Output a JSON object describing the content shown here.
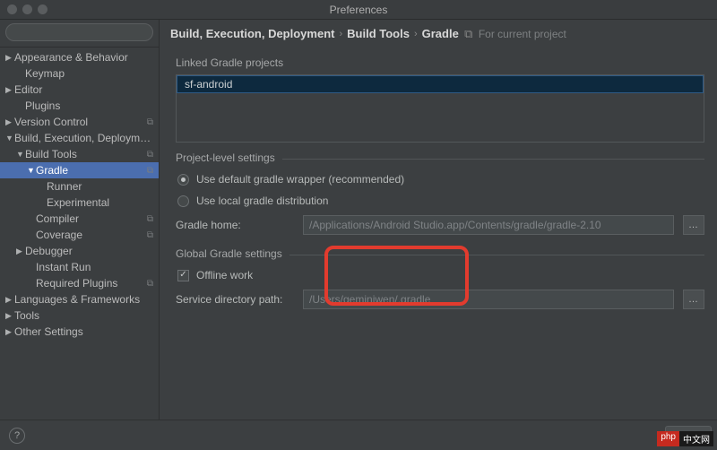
{
  "window": {
    "title": "Preferences"
  },
  "search": {
    "placeholder": ""
  },
  "sidebar": {
    "items": [
      {
        "label": "Appearance & Behavior",
        "indent": 0,
        "arrow": "▶",
        "badge": ""
      },
      {
        "label": "Keymap",
        "indent": 1,
        "arrow": "",
        "badge": ""
      },
      {
        "label": "Editor",
        "indent": 0,
        "arrow": "▶",
        "badge": ""
      },
      {
        "label": "Plugins",
        "indent": 1,
        "arrow": "",
        "badge": ""
      },
      {
        "label": "Version Control",
        "indent": 0,
        "arrow": "▶",
        "badge": "⧉"
      },
      {
        "label": "Build, Execution, Deployment",
        "indent": 0,
        "arrow": "▼",
        "badge": ""
      },
      {
        "label": "Build Tools",
        "indent": 1,
        "arrow": "▼",
        "badge": "⧉"
      },
      {
        "label": "Gradle",
        "indent": 2,
        "arrow": "▼",
        "badge": "⧉",
        "selected": true
      },
      {
        "label": "Runner",
        "indent": 3,
        "arrow": "",
        "badge": ""
      },
      {
        "label": "Experimental",
        "indent": 3,
        "arrow": "",
        "badge": ""
      },
      {
        "label": "Compiler",
        "indent": 2,
        "arrow": "",
        "badge": "⧉"
      },
      {
        "label": "Coverage",
        "indent": 2,
        "arrow": "",
        "badge": "⧉"
      },
      {
        "label": "Debugger",
        "indent": 1,
        "arrow": "▶",
        "badge": ""
      },
      {
        "label": "Instant Run",
        "indent": 2,
        "arrow": "",
        "badge": ""
      },
      {
        "label": "Required Plugins",
        "indent": 2,
        "arrow": "",
        "badge": "⧉"
      },
      {
        "label": "Languages & Frameworks",
        "indent": 0,
        "arrow": "▶",
        "badge": ""
      },
      {
        "label": "Tools",
        "indent": 0,
        "arrow": "▶",
        "badge": ""
      },
      {
        "label": "Other Settings",
        "indent": 0,
        "arrow": "▶",
        "badge": ""
      }
    ]
  },
  "breadcrumbs": {
    "parts": [
      "Build, Execution, Deployment",
      "Build Tools",
      "Gradle"
    ],
    "for_current": "For current project"
  },
  "linked_projects": {
    "title": "Linked Gradle projects",
    "items": [
      "sf-android"
    ]
  },
  "project_settings": {
    "title": "Project-level settings",
    "radio_default": "Use default gradle wrapper (recommended)",
    "radio_local": "Use local gradle distribution",
    "gradle_home_label": "Gradle home:",
    "gradle_home_value": "/Applications/Android Studio.app/Contents/gradle/gradle-2.10"
  },
  "global_settings": {
    "title": "Global Gradle settings",
    "offline_work": "Offline work",
    "offline_checked": true,
    "service_dir_label": "Service directory path:",
    "service_dir_value": "/Users/geminiwen/.gradle"
  },
  "footer": {
    "cancel": "Cancel"
  },
  "watermark": {
    "a": "php",
    "b": "中文网"
  }
}
